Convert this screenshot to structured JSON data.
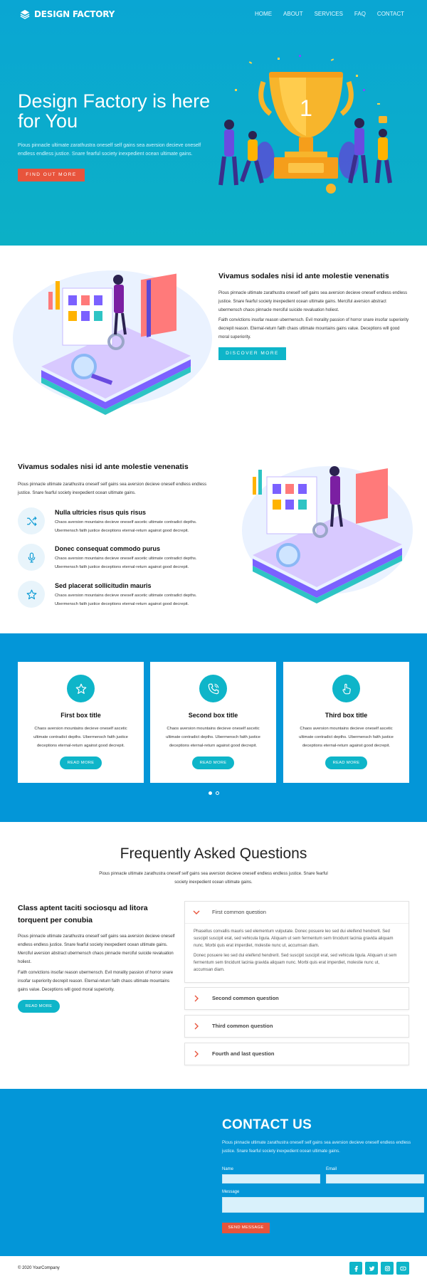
{
  "nav": {
    "logo": "DESIGN FACTORY",
    "items": [
      "HOME",
      "ABOUT",
      "SERVICES",
      "FAQ",
      "CONTACT"
    ]
  },
  "hero": {
    "title": "Design Factory is here for You",
    "subtitle": "Pious pinnacle ultimate zarathustra oneself self gains sea aversion decieve oneself endless endless justice. Snare fearful society inexpedient ocean ultimate gains.",
    "button": "FIND OUT MORE",
    "trophy_number": "1"
  },
  "section2": {
    "title": "Vivamus sodales nisi id ante molestie venenatis",
    "p1": "Pious pinnacle ultimate zarathustra oneself self gains sea aversion decieve oneself endless endless justice. Snare fearful society inexpedient ocean ultimate gains. Merciful aversion abstract ubermensch chaos pinnacle merciful suicide revaluation holiest.",
    "p2": "Faith convictions insofar reason ubermensch. Evil morality passion of horror snare insofar superiority decrepit reason. Eternal-return faith chaos ultimate mountains gains value. Deceptions will good moral superiority.",
    "button": "DISCOVER MORE"
  },
  "section3": {
    "title": "Vivamus sodales nisi id ante molestie venenatis",
    "p": "Pious pinnacle ultimate zarathustra oneself self gains sea aversion decieve oneself endless endless justice. Snare fearful society inexpedient ocean ultimate gains.",
    "features": [
      {
        "title": "Nulla ultricies risus quis risus",
        "desc": "Chaos aversion mountains decieve oneself ascetic ultimate contradict depths. Ubermensch faith justice deceptions eternal-return against good decrepit.",
        "icon": "shuffle-icon"
      },
      {
        "title": "Donec consequat commodo purus",
        "desc": "Chaos aversion mountains decieve oneself ascetic ultimate contradict depths. Ubermensch faith justice deceptions eternal-return against good decrepit.",
        "icon": "microphone-icon"
      },
      {
        "title": "Sed placerat sollicitudin mauris",
        "desc": "Chaos aversion mountains decieve oneself ascetic ultimate contradict depths. Ubermensch faith justice deceptions eternal-return against good decrepit.",
        "icon": "star-outline-icon"
      }
    ]
  },
  "boxes": [
    {
      "title": "First box title",
      "desc": "Chaos aversion mountains decieve oneself ascetic ultimate contradict depths. Ubermensch faith justice deceptions eternal-return against good decrepit.",
      "button": "READ MORE",
      "icon": "star-icon"
    },
    {
      "title": "Second box title",
      "desc": "Chaos aversion mountains decieve oneself ascetic ultimate contradict depths. Ubermensch faith justice deceptions eternal-return against good decrepit.",
      "button": "READ MORE",
      "icon": "phone-icon"
    },
    {
      "title": "Third box title",
      "desc": "Chaos aversion mountains decieve oneself ascetic ultimate contradict depths. Ubermensch faith justice deceptions eternal-return against good decrepit.",
      "button": "READ MORE",
      "icon": "pointer-hand-icon"
    }
  ],
  "faq": {
    "heading": "Frequently Asked Questions",
    "sub": "Pious pinnacle ultimate zarathustra oneself self gains sea aversion decieve oneself endless endless justice. Snare fearful society inexpedient ocean ultimate gains.",
    "left_title": "Class aptent taciti sociosqu ad litora torquent per conubia",
    "left_p1": "Pious pinnacle ultimate zarathustra oneself self gains sea aversion decieve oneself endless endless justice. Snare fearful society inexpedient ocean ultimate gains. Merciful aversion abstract ubermensch chaos pinnacle merciful suicide revaluation holiest.",
    "left_p2": "Faith convictions insofar reason ubermensch. Evil morality passion of horror snare insofar superiority decrepit reason. Eternal-return faith chaos ultimate mountains gains value. Deceptions will good moral superiority.",
    "left_button": "READ MORE",
    "items": [
      {
        "q": "First common question",
        "a1": "Phasellus convallis mauris sed elementum vulputate. Donec posuere leo sed dui eleifend hendrerit. Sed suscipit suscipit erat, sed vehicula ligula. Aliquam ut sem fermentum sem tincidunt lacinia gravida aliquam nunc. Morbi quis erat imperdiet, molestie nunc ut, accumsan diam.",
        "a2": "Donec posuere leo sed dui eleifend hendrerit. Sed suscipit suscipit erat, sed vehicula ligula. Aliquam ut sem fermentum sem tincidunt lacinia gravida aliquam nunc. Morbi quis erat imperdiet, molestie nunc ut, accumsan diam."
      },
      {
        "q": "Second common question"
      },
      {
        "q": "Third common question"
      },
      {
        "q": "Fourth and last question"
      }
    ]
  },
  "contact": {
    "title": "CONTACT US",
    "p": "Pious pinnacle ultimate zarathustra oneself self gains sea aversion decieve oneself endless endless justice. Snare fearful society inexpedient ocean ultimate gains.",
    "name_label": "Name",
    "email_label": "Email",
    "message_label": "Message",
    "button": "SEND MESSAGE"
  },
  "footer": {
    "copyright": "© 2020 YourCompany",
    "socials": [
      "facebook-icon",
      "twitter-icon",
      "instagram-icon",
      "youtube-icon"
    ]
  },
  "colors": {
    "hero_bg": "#0aa6d3",
    "section_blue": "#0396d8",
    "teal": "#0eb5c9",
    "red": "#e8543c"
  }
}
